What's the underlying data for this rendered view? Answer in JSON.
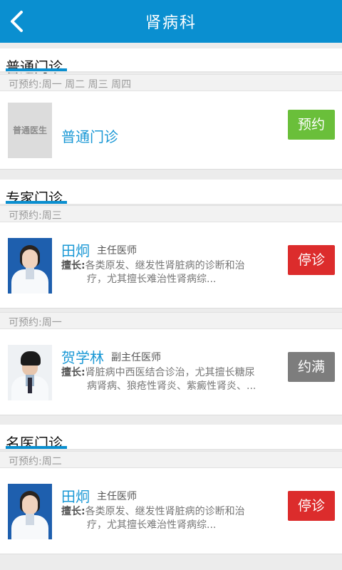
{
  "header": {
    "title": "肾病科"
  },
  "sections": [
    {
      "title": "普通门诊",
      "availability": "可预约:周一 周二 周三 周四",
      "placeholder_label": "普通医生",
      "item_name": "普通门诊",
      "action": "预约"
    },
    {
      "title": "专家门诊",
      "groups": [
        {
          "availability": "可预约:周三",
          "doctor": {
            "name": "田炯",
            "title": "主任医师",
            "spec_key": "擅长:",
            "spec_line1": "各类原发、继发性肾脏病的诊断和治",
            "spec_line2": "疗，尤其擅长难治性肾病综...",
            "action": "停诊"
          }
        },
        {
          "availability": "可预约:周一",
          "doctor": {
            "name": "贺学林",
            "title": "副主任医师",
            "spec_key": "擅长:",
            "spec_line1": "肾脏病中西医结合诊治，尤其擅长糖尿",
            "spec_line2": "病肾病、狼疮性肾炎、紫癜性肾炎、...",
            "action": "约满"
          }
        }
      ]
    },
    {
      "title": "名医门诊",
      "availability": "可预约:周二",
      "doctor": {
        "name": "田炯",
        "title": "主任医师",
        "spec_key": "擅长:",
        "spec_line1": "各类原发、继发性肾脏病的诊断和治",
        "spec_line2": "疗，尤其擅长难治性肾病综...",
        "action": "停诊"
      }
    }
  ],
  "colors": {
    "header": "#0a8fd0",
    "accent": "#1a98d5",
    "book": "#6abf3a",
    "closed": "#dc2c2c",
    "full": "#7d7d7d"
  },
  "icons": {
    "back": "chevron-left-icon"
  }
}
